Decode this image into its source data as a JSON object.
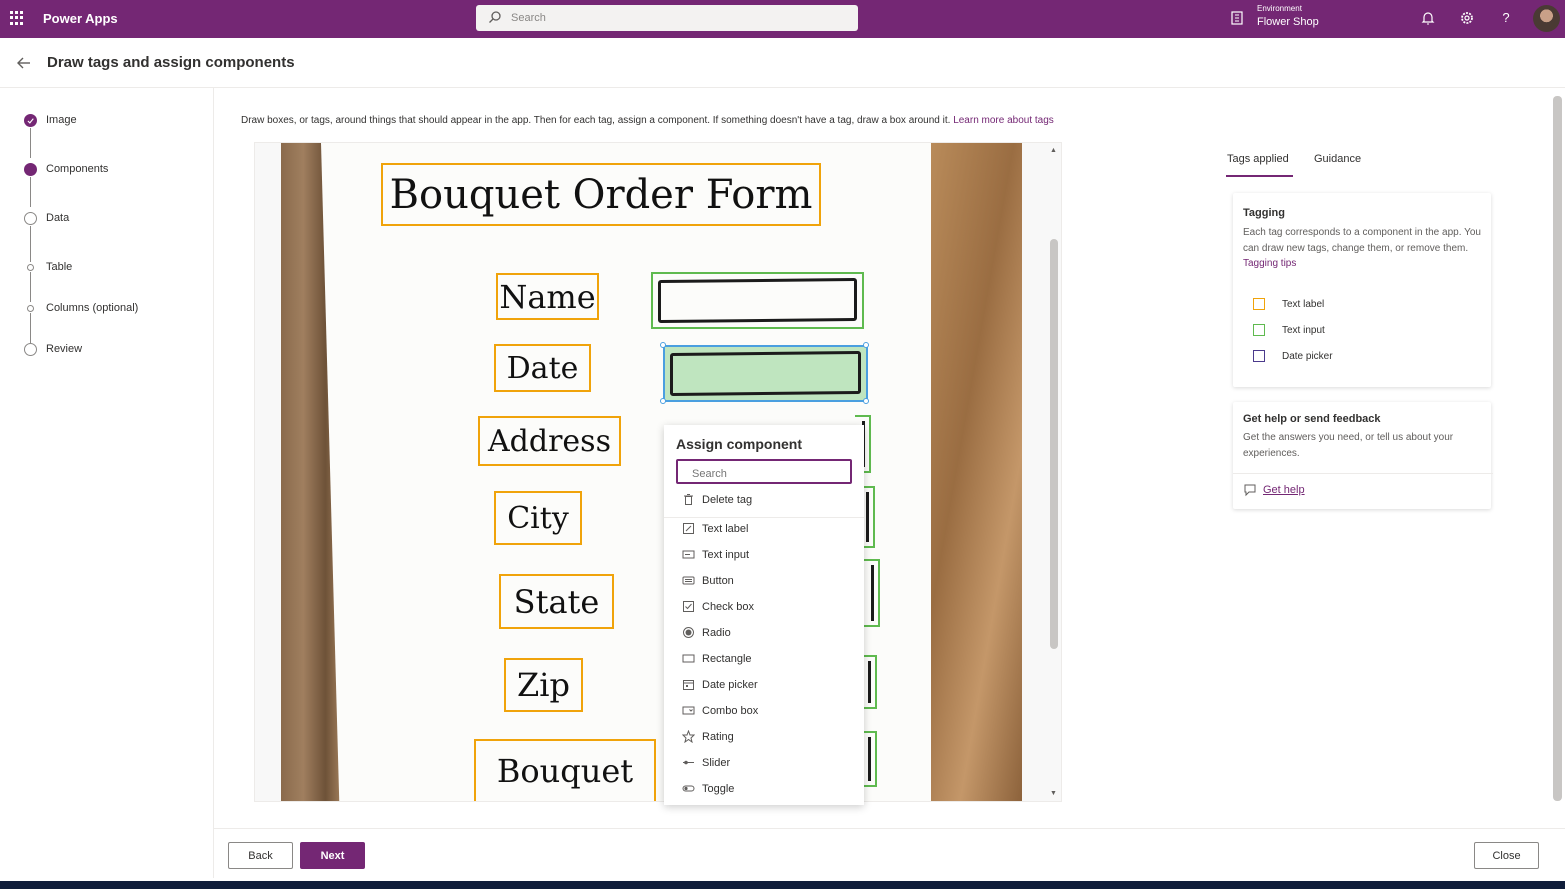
{
  "topbar": {
    "app_name": "Power Apps",
    "search_placeholder": "Search",
    "environment_label": "Environment",
    "environment_name": "Flower Shop"
  },
  "header": {
    "title": "Draw tags and assign components"
  },
  "steps": [
    {
      "label": "Image",
      "state": "done"
    },
    {
      "label": "Components",
      "state": "current"
    },
    {
      "label": "Data",
      "state": "todo"
    },
    {
      "label": "Table",
      "state": "sub"
    },
    {
      "label": "Columns (optional)",
      "state": "sub"
    },
    {
      "label": "Review",
      "state": "todo"
    }
  ],
  "instructions": {
    "text": "Draw boxes, or tags, around things that should appear in the app. Then for each tag, assign a component. If something doesn't have a tag, draw a box around it.",
    "link": "Learn more about tags"
  },
  "form_image": {
    "title": "Bouquet Order Form",
    "labels": [
      "Name",
      "Date",
      "Address",
      "City",
      "State",
      "Zip",
      "Bouquet"
    ]
  },
  "assign_popup": {
    "title": "Assign component",
    "search_placeholder": "Search",
    "delete": "Delete tag",
    "items": [
      "Text label",
      "Text input",
      "Button",
      "Check box",
      "Radio",
      "Rectangle",
      "Date picker",
      "Combo box",
      "Rating",
      "Slider",
      "Toggle"
    ]
  },
  "right_panel": {
    "tabs": [
      "Tags applied",
      "Guidance"
    ],
    "tagging": {
      "title": "Tagging",
      "desc": "Each tag corresponds to a component in the app. You can draw new tags, change them, or remove them.",
      "link": "Tagging tips",
      "legend": [
        {
          "label": "Text label",
          "color": "#f0a30a"
        },
        {
          "label": "Text input",
          "color": "#5fba4f"
        },
        {
          "label": "Date picker",
          "color": "#4b3a8c"
        }
      ]
    },
    "help": {
      "title": "Get help or send feedback",
      "desc": "Get the answers you need, or tell us about your experiences.",
      "link": "Get help"
    }
  },
  "footer": {
    "back": "Back",
    "next": "Next",
    "close": "Close"
  },
  "colors": {
    "brand": "#742774",
    "text_label_tag": "#f0a30a",
    "text_input_tag": "#5fba4f"
  }
}
